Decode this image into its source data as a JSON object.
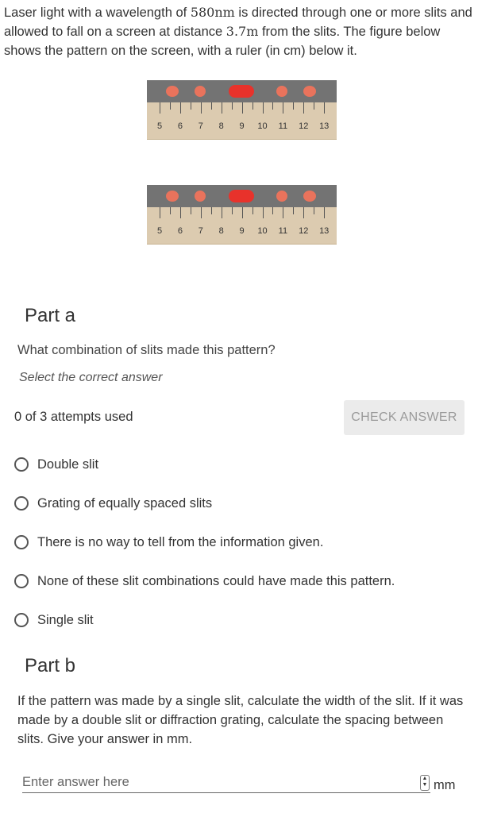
{
  "intro": {
    "before_wavelength": "Laser light with a wavelength of ",
    "wavelength": "580nm",
    "middle": " is directed through one or more slits and allowed to fall on a screen at distance ",
    "distance": "3.7m",
    "after": " from the slits. The figure below shows the pattern on the screen, with a ruler (in cm) below it."
  },
  "ruler": {
    "tick_labels": [
      "5",
      "6",
      "7",
      "8",
      "9",
      "10",
      "11",
      "12",
      "13"
    ],
    "colors": {
      "screen": "#737373",
      "ruler": "#dccbb0",
      "spot_bright": "#e8322b",
      "spot_dim": "#e9735c"
    }
  },
  "part_a": {
    "title": "Part a",
    "question": "What combination of slits made this pattern?",
    "hint": "Select the correct answer",
    "attempts": "0 of 3 attempts used",
    "check_label": "CHECK ANSWER",
    "options": [
      "Double slit",
      "Grating of equally spaced slits",
      "There is no way to tell from the information given.",
      "None of these slit combinations could have made this pattern.",
      "Single slit"
    ]
  },
  "part_b": {
    "title": "Part b",
    "question": "If the pattern was made by a single slit, calculate the width of the slit. If it was made by a double slit or diffraction grating, calculate the spacing between slits. Give your answer in mm.",
    "placeholder": "Enter answer here",
    "unit": "mm"
  }
}
